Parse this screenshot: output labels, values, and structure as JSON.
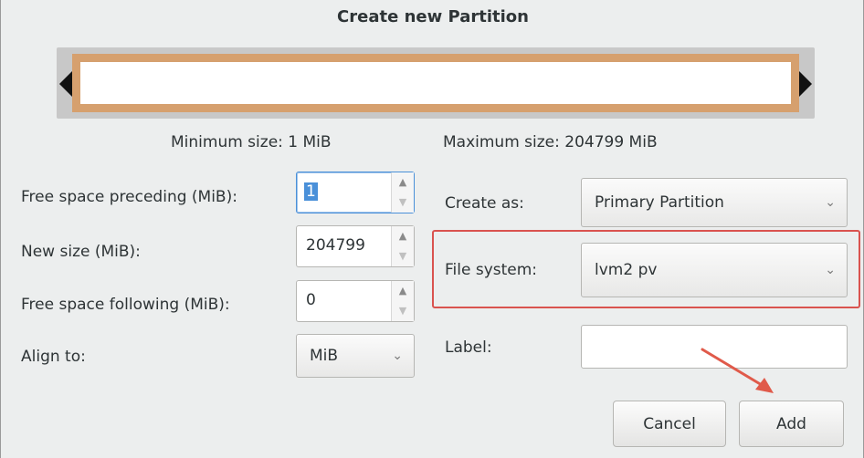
{
  "dialog": {
    "title": "Create new Partition"
  },
  "partition_bar": {
    "fill_color": "#d6a06e"
  },
  "info": {
    "minimum": "Minimum size: 1 MiB",
    "maximum": "Maximum size: 204799 MiB"
  },
  "left": {
    "free_preceding": {
      "label": "Free space preceding (MiB):",
      "value": "1"
    },
    "new_size": {
      "label": "New size (MiB):",
      "value": "204799"
    },
    "free_following": {
      "label": "Free space following (MiB):",
      "value": "0"
    },
    "align_to": {
      "label": "Align to:",
      "value": "MiB"
    }
  },
  "right": {
    "create_as": {
      "label": "Create as:",
      "value": "Primary Partition"
    },
    "file_system": {
      "label": "File system:",
      "value": "lvm2 pv"
    },
    "label": {
      "label": "Label:",
      "value": ""
    }
  },
  "buttons": {
    "cancel": "Cancel",
    "add": "Add"
  },
  "annotation": {
    "highlight_color": "#d9534f",
    "arrow_color": "#e05a4a"
  }
}
